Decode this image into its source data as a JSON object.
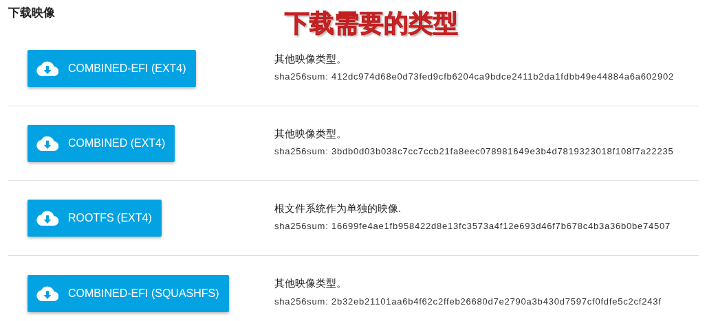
{
  "heading": "下载映像",
  "annotation": "下载需要的类型",
  "images": [
    {
      "button": "COMBINED-EFI (EXT4)",
      "description": "其他映像类型。",
      "checksum": "sha256sum: 412dc974d68e0d73fed9cfb6204ca9bdce2411b2da1fdbb49e44884a6a602902"
    },
    {
      "button": "COMBINED (EXT4)",
      "description": "其他映像类型。",
      "checksum": "sha256sum: 3bdb0d03b038c7cc7ccb21fa8eec078981649e3b4d7819323018f108f7a22235"
    },
    {
      "button": "ROOTFS (EXT4)",
      "description": "根文件系统作为单独的映像.",
      "checksum": "sha256sum: 16699fe4ae1fb958422d8e13fc3573a4f12e693d46f7b678c4b3a36b0be74507"
    },
    {
      "button": "COMBINED-EFI (SQUASHFS)",
      "description": "其他映像类型。",
      "checksum": "sha256sum: 2b32eb21101aa6b4f62c2ffeb26680d7e2790a3b430d7597cf0fdfe5c2cf243f"
    }
  ]
}
